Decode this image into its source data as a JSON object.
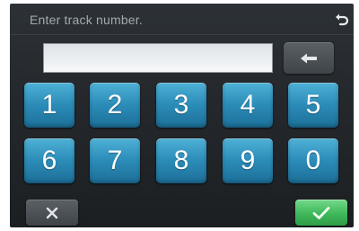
{
  "header": {
    "prompt": "Enter track number.",
    "back_icon": "return-arrow-icon"
  },
  "entry": {
    "value": "",
    "backspace_icon": "left-arrow-icon"
  },
  "keypad": {
    "keys": [
      "1",
      "2",
      "3",
      "4",
      "5",
      "6",
      "7",
      "8",
      "9",
      "0"
    ]
  },
  "footer": {
    "cancel_icon": "x-icon",
    "confirm_icon": "checkmark-icon"
  },
  "colors": {
    "key_blue": "#2c8db9",
    "confirm_green": "#3fb85a",
    "panel_dark": "#24282c"
  }
}
